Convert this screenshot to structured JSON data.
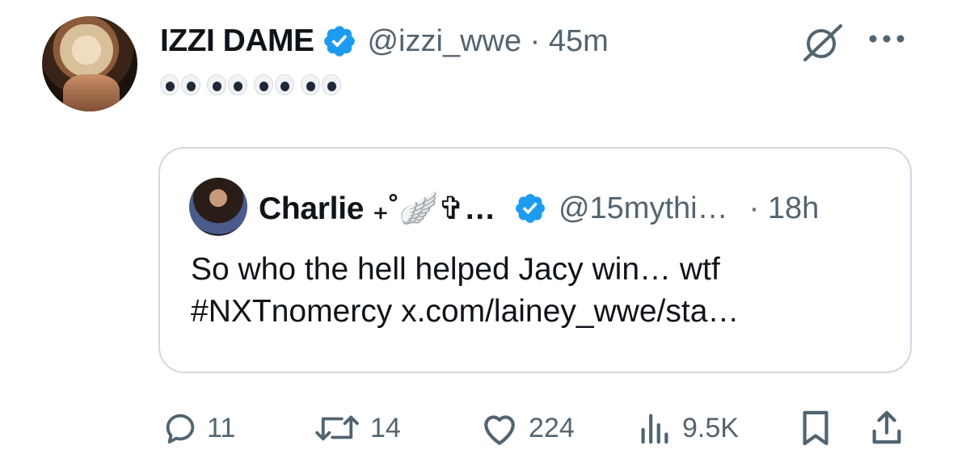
{
  "tweet": {
    "author_name": "IZZI DAME",
    "handle_time": "@izzi_wwe · 45m",
    "body_emojis": "👀👀👀👀",
    "colors": {
      "verified": "#1d9bf0",
      "secondary_text": "#536471",
      "primary_text": "#0f1419"
    },
    "icons": {
      "grok": "grok-icon",
      "more": "more-icon"
    }
  },
  "quote": {
    "author_name": "Charlie ₊˚🪽✞…",
    "handle": "@15mythi…",
    "time": "· 18h",
    "text_line1": "So who the hell helped Jacy win… wtf",
    "text_line2": "#NXTnomercy x.com/lainey_wwe/sta…"
  },
  "actions": {
    "replies": "11",
    "reposts": "14",
    "likes": "224",
    "views": "9.5K",
    "icons": [
      "reply-icon",
      "repost-icon",
      "like-icon",
      "views-icon",
      "bookmark-icon",
      "share-icon"
    ]
  }
}
